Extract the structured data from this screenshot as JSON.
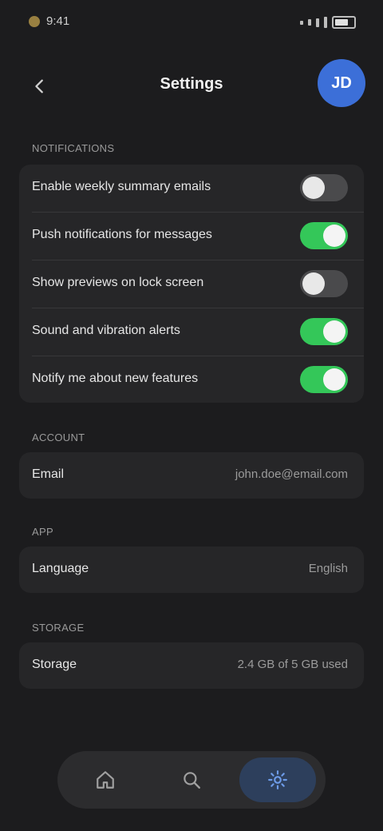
{
  "status_bar": {
    "time": "9:41"
  },
  "nav": {
    "title": "Settings",
    "avatar_initials": "JD"
  },
  "toggles": {
    "section_label": "NOTIFICATIONS",
    "items": [
      {
        "label": "Enable weekly summary emails",
        "on": false
      },
      {
        "label": "Push notifications for messages",
        "on": true
      },
      {
        "label": "Show previews on lock screen",
        "on": false
      },
      {
        "label": "Sound and vibration alerts",
        "on": true
      },
      {
        "label": "Notify me about new features",
        "on": true
      }
    ]
  },
  "account": {
    "section_label": "ACCOUNT",
    "label": "Email",
    "value": "john.doe@email.com"
  },
  "language": {
    "section_label": "APP",
    "label": "Language",
    "value": "English"
  },
  "storage": {
    "section_label": "STORAGE",
    "label": "Storage",
    "value": "2.4 GB of 5 GB used"
  },
  "tabs": [
    {
      "name": "home",
      "icon": "home-icon"
    },
    {
      "name": "search",
      "icon": "search-icon"
    },
    {
      "name": "settings",
      "icon": "settings-icon",
      "active": true
    }
  ],
  "colors": {
    "accent": "#3c6fd8",
    "toggle_on": "#34c759",
    "background": "#1c1c1e"
  }
}
